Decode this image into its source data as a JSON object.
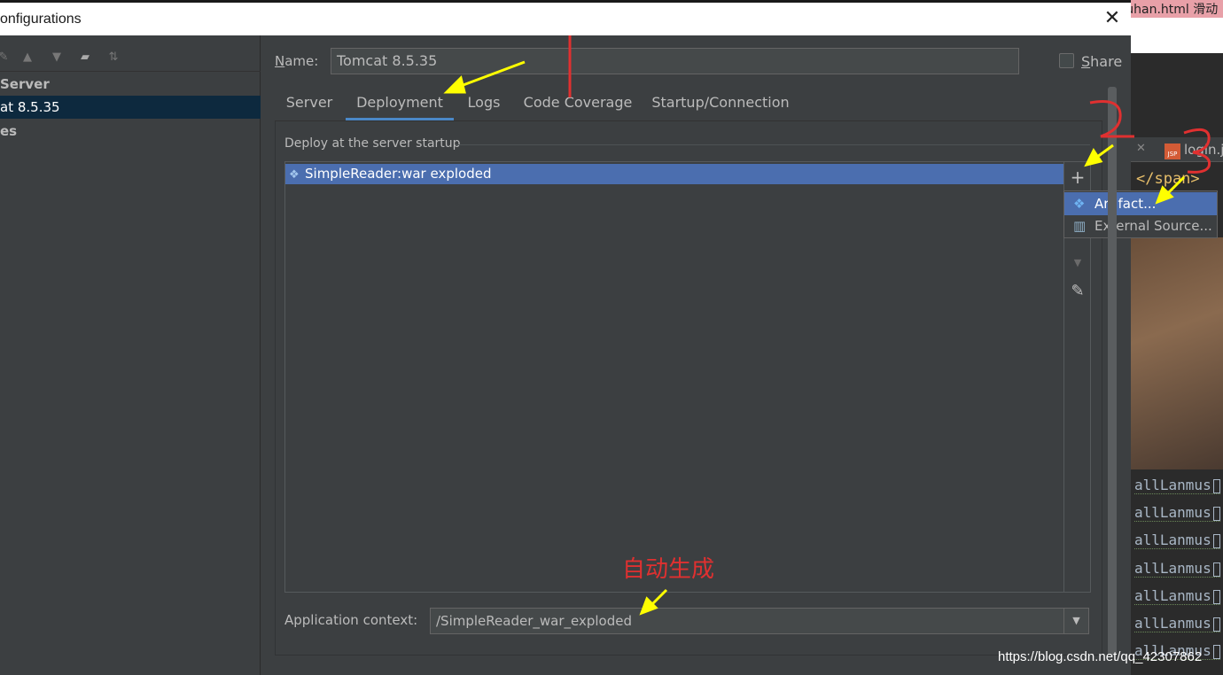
{
  "window": {
    "title": "onfigurations",
    "close_glyph": "✕"
  },
  "background": {
    "top_tab_text": "vuhan.html  滑动",
    "editor_tab_close": "✕",
    "editor_tab_icon_text": "JSP",
    "editor_tab_label": "login.j",
    "editor_tag": "</span>",
    "code_lines": [
      "allLanmus",
      "allLanmus",
      "allLanmus",
      "allLanmus",
      "allLanmus",
      "allLanmus",
      "allLanmus"
    ],
    "watermark": "https://blog.csdn.net/qq_42307862"
  },
  "left": {
    "toolbar_icons": [
      "wrench-icon",
      "arrow-up-icon",
      "arrow-down-icon",
      "new-folder-icon",
      "sort-icon"
    ],
    "toolbar_glyphs": [
      "✎",
      "▲",
      "▼",
      "▰",
      "⇅"
    ],
    "tree": [
      {
        "label": "Server",
        "bold": true,
        "selected": false
      },
      {
        "label": "at 8.5.35",
        "bold": false,
        "selected": true
      },
      {
        "label": "es",
        "bold": true,
        "selected": false
      }
    ]
  },
  "name": {
    "label_underline": "N",
    "label_rest": "ame:",
    "value": "Tomcat 8.5.35"
  },
  "share": {
    "label_underline": "S",
    "label_rest": "hare",
    "checked": false
  },
  "tabs": [
    {
      "label": "Server",
      "active": false
    },
    {
      "label": "Deployment",
      "active": true
    },
    {
      "label": "Logs",
      "active": false
    },
    {
      "label": "Code Coverage",
      "active": false
    },
    {
      "label": "Startup/Connection",
      "active": false
    }
  ],
  "deployment": {
    "group_label": "Deploy at the server startup",
    "items": [
      {
        "label": "SimpleReader:war exploded",
        "icon": "artifact-icon",
        "selected": true
      }
    ],
    "tools": {
      "add": "+",
      "remove": "−",
      "up": "▲",
      "down": "▼",
      "edit": "✎"
    }
  },
  "popup": {
    "items": [
      {
        "label": "Artifact...",
        "icon": "artifact-icon",
        "glyph": "❖",
        "selected": true
      },
      {
        "label": "External Source...",
        "icon": "external-source-icon",
        "glyph": "▥",
        "selected": false
      }
    ]
  },
  "app_context": {
    "label": "Application context:",
    "value": "/SimpleReader_war_exploded",
    "arrow": "▼"
  },
  "annotations": {
    "auto_generated": "自动生成",
    "red_color": "#e03030",
    "yellow_color": "#ffff00"
  },
  "colors": {
    "accent": "#4a88c7",
    "selection": "#4b6eaf",
    "dialog_bg": "#3c3f41"
  }
}
